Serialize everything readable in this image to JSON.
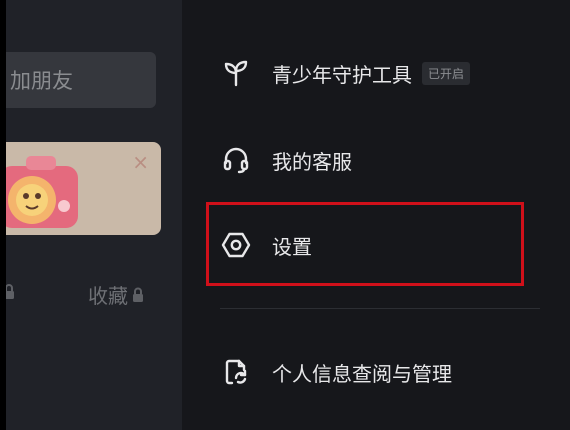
{
  "profile": {
    "add_friend_text": "加朋友",
    "promo_close": "×",
    "tabs": {
      "collect_label": "收藏"
    }
  },
  "drawer": {
    "items": [
      {
        "label": "青少年守护工具",
        "badge": "已开启",
        "icon": "sprout-icon"
      },
      {
        "label": "我的客服",
        "icon": "headset-icon"
      },
      {
        "label": "设置",
        "icon": "settings-hexagon-icon"
      },
      {
        "label": "个人信息查阅与管理",
        "icon": "document-refresh-icon"
      }
    ]
  },
  "colors": {
    "drawer_bg": "#16171b",
    "left_bg": "#202228",
    "highlight": "#d0101a",
    "text": "#e8e8ea"
  }
}
